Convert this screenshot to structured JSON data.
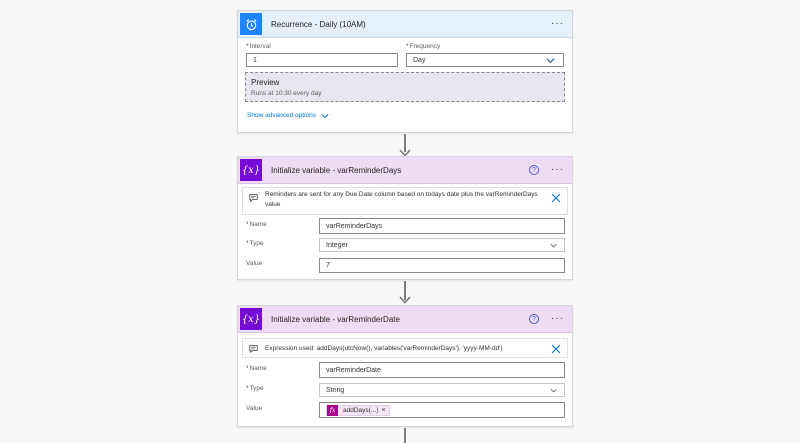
{
  "recurrence": {
    "title": "Recurrence - Daily (10AM)",
    "more": "···",
    "interval_label": "Interval",
    "interval_value": "1",
    "frequency_label": "Frequency",
    "frequency_value": "Day",
    "preview_title": "Preview",
    "preview_text": "Runs at 10:30 every day",
    "advanced_link": "Show advanced options"
  },
  "init_days": {
    "title": "Initialize variable - varReminderDays",
    "help": "?",
    "more": "···",
    "comment": "Reminders are sent for any Due Date column based on todays date plus the varReminderDays value",
    "name_label": "Name",
    "name_value": "varReminderDays",
    "type_label": "Type",
    "type_value": "Integer",
    "value_label": "Value",
    "value_value": "7"
  },
  "init_date": {
    "title": "Initialize variable - varReminderDate",
    "help": "?",
    "more": "···",
    "comment": "Expression used: addDays(utcNow(), variables('varReminderDays'), 'yyyy-MM-dd')",
    "name_label": "Name",
    "name_value": "varReminderDate",
    "type_label": "Type",
    "type_value": "String",
    "value_label": "Value",
    "token_icon": "fx",
    "token_label": "addDays(...)",
    "token_remove": "×"
  },
  "colors": {
    "recurrence_accent": "#1f85ff",
    "variable_accent": "#770bd6",
    "expression_token": "#ad008c",
    "link": "#0078d4"
  },
  "icons": {
    "recurrence": "alarm-clock-icon",
    "variable": "curly-x-icon",
    "comment": "comment-icon",
    "close": "close-icon",
    "chevron": "chevron-down-icon",
    "help": "help-circle-icon"
  }
}
